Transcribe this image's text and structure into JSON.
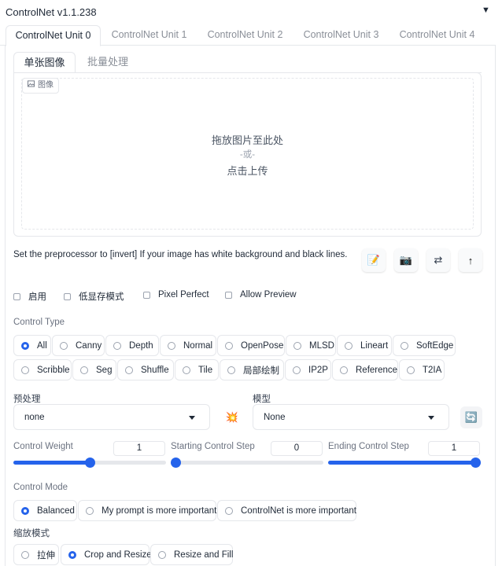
{
  "header": {
    "title": "ControlNet v1.1.238",
    "collapse_glyph": "▼"
  },
  "unit_tabs": [
    "ControlNet Unit 0",
    "ControlNet Unit 1",
    "ControlNet Unit 2",
    "ControlNet Unit 3",
    "ControlNet Unit 4"
  ],
  "image_tabs": [
    "单张图像",
    "批量处理"
  ],
  "upload": {
    "label": "图像",
    "drop_line1": "拖放图片至此处",
    "drop_line2": "-或-",
    "drop_line3": "点击上传"
  },
  "note": "Set the preprocessor to [invert] If your image has white background and black lines.",
  "tool_buttons": [
    {
      "name": "new-canvas-icon",
      "glyph": "📝"
    },
    {
      "name": "camera-icon",
      "glyph": "📷"
    },
    {
      "name": "swap-icon",
      "glyph": "⇄"
    },
    {
      "name": "send-dimensions-icon",
      "glyph": "↑"
    }
  ],
  "checkboxes": [
    "启用",
    "低显存模式",
    "Pixel Perfect",
    "Allow Preview"
  ],
  "control_type": {
    "label": "Control Type",
    "options": [
      "All",
      "Canny",
      "Depth",
      "Normal",
      "OpenPose",
      "MLSD",
      "Lineart",
      "SoftEdge",
      "Scribble",
      "Seg",
      "Shuffle",
      "Tile",
      "局部绘制",
      "IP2P",
      "Reference",
      "T2IA"
    ],
    "selected": "All"
  },
  "preprocessor": {
    "label": "预处理",
    "value": "none",
    "run_glyph": "💥"
  },
  "model": {
    "label": "模型",
    "value": "None",
    "refresh_glyph": "🔄"
  },
  "sliders": [
    {
      "label": "Control Weight",
      "value": "1",
      "fraction": 0.5
    },
    {
      "label": "Starting Control Step",
      "value": "0",
      "fraction": 0.0
    },
    {
      "label": "Ending Control Step",
      "value": "1",
      "fraction": 1.0
    }
  ],
  "control_mode": {
    "label": "Control Mode",
    "options": [
      "Balanced",
      "My prompt is more important",
      "ControlNet is more important"
    ],
    "selected": "Balanced"
  },
  "resize_mode": {
    "label": "缩放模式",
    "options": [
      "拉伸",
      "Crop and Resize",
      "Resize and Fill"
    ],
    "selected": "Crop and Resize"
  },
  "colors": {
    "accent": "#2563eb",
    "border": "#e5e7eb",
    "muted": "#6b7280"
  }
}
